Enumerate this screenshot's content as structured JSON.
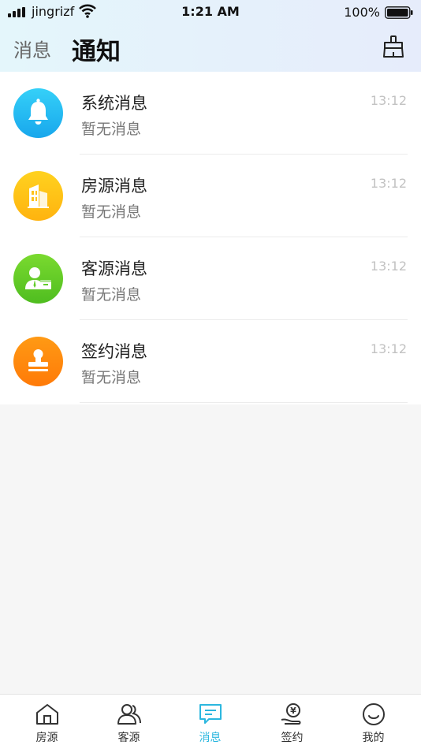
{
  "status_bar": {
    "carrier": "jingrizf",
    "time": "1:21 AM",
    "battery": "100%"
  },
  "header": {
    "back_label": "消息",
    "title": "通知",
    "clean_icon": "broom-icon"
  },
  "notifications": [
    {
      "title": "系统消息",
      "subtitle": "暂无消息",
      "time": "13:12",
      "icon": "bell-icon",
      "color": "#22b9f0"
    },
    {
      "title": "房源消息",
      "subtitle": "暂无消息",
      "time": "13:12",
      "icon": "building-icon",
      "color": "#ffc21a"
    },
    {
      "title": "客源消息",
      "subtitle": "暂无消息",
      "time": "13:12",
      "icon": "client-icon",
      "color": "#62cc2a"
    },
    {
      "title": "签约消息",
      "subtitle": "暂无消息",
      "time": "13:12",
      "icon": "stamp-icon",
      "color": "#ff8c10"
    }
  ],
  "tabbar": {
    "active_color": "#2cb7df",
    "items": [
      {
        "label": "房源",
        "icon": "house-icon"
      },
      {
        "label": "客源",
        "icon": "people-icon"
      },
      {
        "label": "消息",
        "icon": "message-icon",
        "active": true
      },
      {
        "label": "签约",
        "icon": "coin-hand-icon"
      },
      {
        "label": "我的",
        "icon": "smiley-icon"
      }
    ]
  }
}
